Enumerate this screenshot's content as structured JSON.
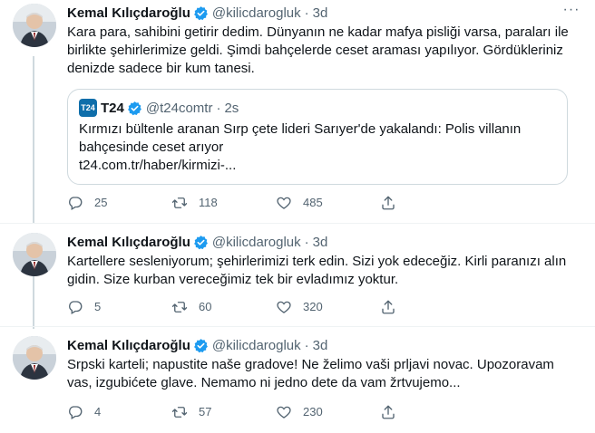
{
  "tweets": [
    {
      "name": "Kemal Kılıçdaroğlu",
      "handle": "@kilicdarogluk",
      "time": "3d",
      "text": "Kara para, sahibini getirir dedim. Dünyanın ne kadar mafya pisliği varsa, paraları ile birlikte şehirlerimize geldi. Şimdi bahçelerde ceset araması yapılıyor. Gördükleriniz denizde sadece bir kum tanesi.",
      "quote": {
        "avatar_text": "T24",
        "name": "T24",
        "handle": "@t24comtr",
        "time": "2s",
        "text": "Kırmızı bültenle aranan Sırp çete lideri Sarıyer'de yakalandı: Polis villanın bahçesinde ceset arıyor",
        "link": "t24.com.tr/haber/kirmizi-..."
      },
      "replies": "25",
      "retweets": "118",
      "likes": "485"
    },
    {
      "name": "Kemal Kılıçdaroğlu",
      "handle": "@kilicdarogluk",
      "time": "3d",
      "text": "Kartellere sesleniyorum; şehirlerimizi terk edin. Sizi yok edeceğiz. Kirli paranızı alın gidin. Size kurban vereceğimiz tek bir evladımız yoktur.",
      "replies": "5",
      "retweets": "60",
      "likes": "320"
    },
    {
      "name": "Kemal Kılıçdaroğlu",
      "handle": "@kilicdarogluk",
      "time": "3d",
      "text": "Srpski karteli; napustite naše gradove! Ne želimo vaši prljavi novac. Upozoravam vas, izgubićete glave. Nemamo ni jedno dete da vam žrtvujemo...",
      "replies": "4",
      "retweets": "57",
      "likes": "230"
    }
  ],
  "colors": {
    "accent": "#1d9bf0",
    "muted": "#536471",
    "border": "#cfd9de"
  },
  "icons": [
    "verified-icon",
    "more-icon",
    "reply-icon",
    "retweet-icon",
    "like-icon",
    "share-icon"
  ]
}
